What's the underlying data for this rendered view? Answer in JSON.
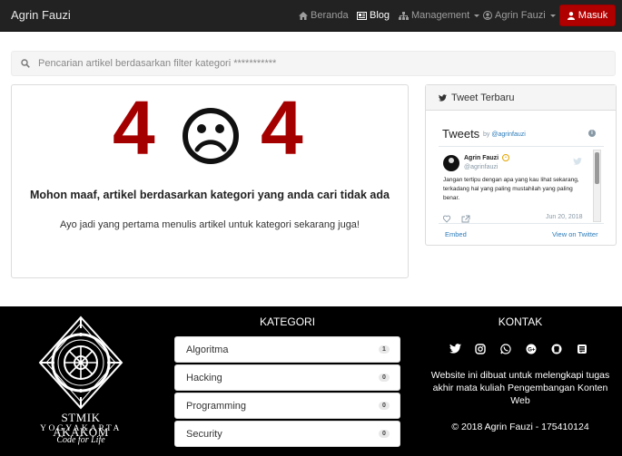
{
  "navbar": {
    "brand": "Agrin Fauzi",
    "items": [
      {
        "label": "Beranda",
        "icon": "home-icon"
      },
      {
        "label": "Blog",
        "icon": "newspaper-icon",
        "active": true
      },
      {
        "label": "Management",
        "icon": "sitemap-icon",
        "dropdown": true
      },
      {
        "label": "Agrin Fauzi",
        "icon": "user-circle-icon",
        "dropdown": true
      }
    ],
    "login_label": "Masuk"
  },
  "search": {
    "placeholder": "Pencarian artikel berdasarkan filter kategori ***********"
  },
  "error": {
    "digit_left": "4",
    "digit_right": "4",
    "title": "Mohon maaf, artikel berdasarkan kategori yang anda cari tidak ada",
    "subtitle": "Ayo jadi yang pertama menulis artikel untuk kategori sekarang juga!"
  },
  "tweet_panel": {
    "heading": "Tweet Terbaru",
    "widget_title": "Tweets",
    "by_prefix": "by",
    "by_handle": "@agrinfauzi",
    "tweet": {
      "name": "Agrin Fauzi",
      "handle": "@agrinfauzi",
      "text": "Jangan tertipu dengan apa yang kau lihat sekarang, terkadang hal yang paling mustahilah yang paling benar.",
      "date": "Jun 20, 2018"
    },
    "embed_label": "Embed",
    "view_label": "View on Twitter"
  },
  "footer": {
    "logo_name": "STMIK AKAKOM",
    "logo_city": "YOGYAKARTA",
    "logo_motto": "Code for Life",
    "categories_title": "KATEGORI",
    "categories": [
      {
        "name": "Algoritma",
        "count": "1"
      },
      {
        "name": "Hacking",
        "count": "0"
      },
      {
        "name": "Programming",
        "count": "0"
      },
      {
        "name": "Security",
        "count": "0"
      }
    ],
    "contact_title": "KONTAK",
    "social_icons": [
      "twitter-icon",
      "instagram-icon",
      "whatsapp-icon",
      "google-plus-icon",
      "github-icon",
      "stack-exchange-icon"
    ],
    "contact_text": "Website ini dibuat untuk melengkapi tugas akhir mata kuliah Pengembangan Konten Web",
    "copyright": "© 2018 Agrin Fauzi - 175410124"
  },
  "colors": {
    "navbar_bg": "#222222",
    "accent_red": "#a50000",
    "button_red": "#b00000",
    "footer_bg": "#000000",
    "link_blue": "#2b7bb9"
  }
}
